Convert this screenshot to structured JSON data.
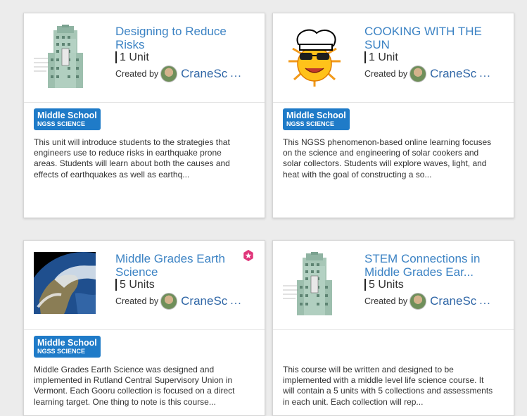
{
  "cards": [
    {
      "title": "Designing to Reduce Risks",
      "units": "1 Unit",
      "created_by": "Created by",
      "creator": "CraneSc",
      "more": "...",
      "badge_level": "Middle School",
      "badge_subject": "NGSS SCIENCE",
      "description": "This unit will introduce students to the strategies that engineers use to reduce risks in earthquake prone areas. Students will learn about both the causes and effects of earthquakes as well as earthq...",
      "thumb": "building-image"
    },
    {
      "title": "COOKING WITH THE SUN",
      "units": "1 Unit",
      "created_by": "Created by",
      "creator": "CraneSc",
      "more": "...",
      "badge_level": "Middle School",
      "badge_subject": "NGSS SCIENCE",
      "description": "This NGSS phenomenon-based online learning focuses on the science and engineering of solar cookers and solar collectors. Students will explore waves, light, and heat with the goal of constructing a so...",
      "thumb": "sun-chef-image"
    },
    {
      "title": "Middle Grades Earth Science",
      "units": "5 Units",
      "created_by": "Created by",
      "creator": "CraneSc",
      "more": "...",
      "badge_level": "Middle School",
      "badge_subject": "NGSS SCIENCE",
      "description": "Middle Grades Earth Science was designed and implemented in Rutland Central Supervisory Union in Vermont. Each Gooru collection is focused on a direct learning target. One thing to note is this course...",
      "thumb": "earth-image",
      "featured": true
    },
    {
      "title": "STEM Connections in Middle Grades Ear...",
      "units": "5 Units",
      "created_by": "Created by",
      "creator": "CraneSc",
      "more": "...",
      "description": "This course will be written and designed to be implemented with a middle level life science course. It will contain a 5 units with 5 collections and assessments in each unit. Each collection will rep...",
      "thumb": "building-image"
    }
  ],
  "colors": {
    "accent": "#3c83c4",
    "badge": "#1f7bc8",
    "featured": "#e0357a"
  }
}
